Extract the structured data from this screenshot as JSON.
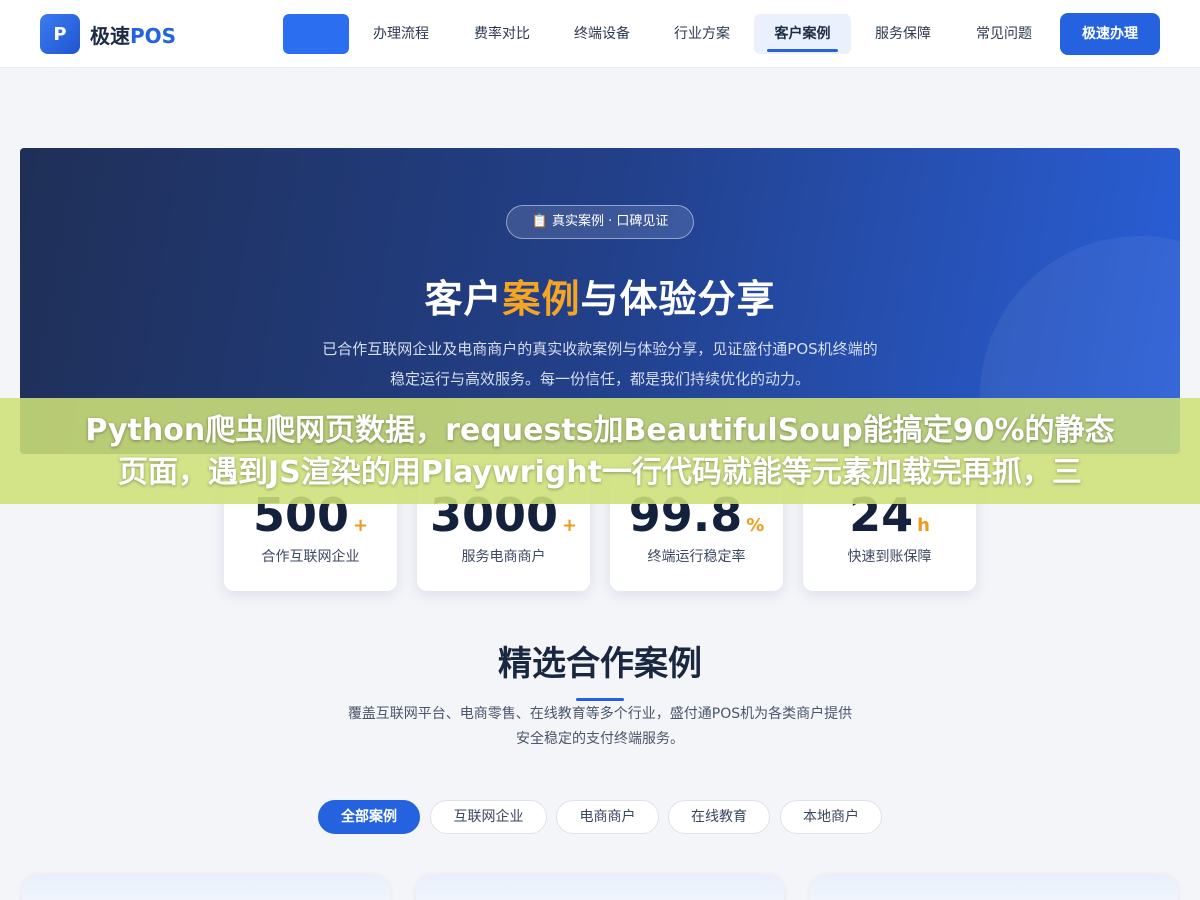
{
  "header": {
    "logo_letter": "P",
    "logo_name": "极速",
    "logo_accent": "POS",
    "nav": [
      {
        "label": "办理流程"
      },
      {
        "label": "费率对比"
      },
      {
        "label": "终端设备"
      },
      {
        "label": "行业方案"
      },
      {
        "label": "客户案例",
        "active": true
      },
      {
        "label": "服务保障"
      },
      {
        "label": "常见问题"
      }
    ],
    "cta_label": "极速办理"
  },
  "hero": {
    "badge_icon": "📋",
    "badge_text": "真实案例 · 口碑见证",
    "title_pre": "客户",
    "title_highlight": "案例",
    "title_post": "与体验分享",
    "desc_line1": "已合作互联网企业及电商商户的真实收款案例与体验分享，见证盛付通POS机终端的",
    "desc_line2": "稳定运行与高效服务。每一份信任，都是我们持续优化的动力。"
  },
  "stats": [
    {
      "value": "500",
      "suffix": "+",
      "label": "合作互联网企业"
    },
    {
      "value": "3000",
      "suffix": "+",
      "label": "服务电商商户"
    },
    {
      "value": "99.8",
      "suffix": "%",
      "label": "终端运行稳定率"
    },
    {
      "value": "24",
      "suffix": "h",
      "label": "快速到账保障"
    }
  ],
  "overlay": {
    "line1": "Python爬虫爬网页数据，requests加BeautifulSoup能搞定90%的静态",
    "line2": "页面，遇到JS渲染的用Playwright一行代码就能等元素加载完再抓，三"
  },
  "featured": {
    "title": "精选合作案例",
    "desc_line1": "覆盖互联网平台、电商零售、在线教育等多个行业，盛付通POS机为各类商户提供",
    "desc_line2": "安全稳定的支付终端服务。",
    "tabs": [
      {
        "label": "全部案例",
        "active": true
      },
      {
        "label": "互联网企业"
      },
      {
        "label": "电商商户"
      },
      {
        "label": "在线教育"
      },
      {
        "label": "本地商户"
      }
    ]
  },
  "colors": {
    "brand": "#2462e0",
    "accent": "#f5a524",
    "overlay": "#cde078"
  }
}
